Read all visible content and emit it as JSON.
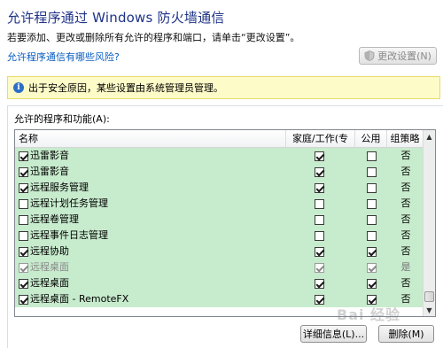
{
  "header": {
    "title": "允许程序通过 Windows 防火墙通信",
    "subtitle": "若要添加、更改或删除所有允许的程序和端口，请单击“更改设置”。",
    "help_link": "允许程序通信有哪些风险?",
    "change_settings_label": "更改设置(N)"
  },
  "infobar": {
    "text": "出于安全原因，某些设置由系统管理员管理。",
    "icon": "info-icon"
  },
  "programs": {
    "group_label": "允许的程序和功能(A):",
    "columns": {
      "name": "名称",
      "home": "家庭/工作(专用)",
      "public": "公用",
      "group_policy": "组策略"
    },
    "rows": [
      {
        "name": "迅雷影音",
        "enabled": true,
        "home": true,
        "public": false,
        "policy": "否",
        "disabled": false
      },
      {
        "name": "迅雷影音",
        "enabled": true,
        "home": true,
        "public": false,
        "policy": "否",
        "disabled": false
      },
      {
        "name": "远程服务管理",
        "enabled": true,
        "home": true,
        "public": false,
        "policy": "否",
        "disabled": false
      },
      {
        "name": "远程计划任务管理",
        "enabled": false,
        "home": false,
        "public": false,
        "policy": "否",
        "disabled": false
      },
      {
        "name": "远程卷管理",
        "enabled": false,
        "home": false,
        "public": false,
        "policy": "否",
        "disabled": false
      },
      {
        "name": "远程事件日志管理",
        "enabled": false,
        "home": false,
        "public": false,
        "policy": "否",
        "disabled": false
      },
      {
        "name": "远程协助",
        "enabled": true,
        "home": true,
        "public": true,
        "policy": "否",
        "disabled": false
      },
      {
        "name": "远程桌面",
        "enabled": true,
        "home": true,
        "public": true,
        "policy": "是",
        "disabled": true
      },
      {
        "name": "远程桌面",
        "enabled": true,
        "home": true,
        "public": true,
        "policy": "否",
        "disabled": false
      },
      {
        "name": "远程桌面 - RemoteFX",
        "enabled": true,
        "home": true,
        "public": true,
        "policy": "否",
        "disabled": false
      }
    ],
    "scroll_up": "▲",
    "scroll_down": "▼"
  },
  "footer": {
    "details_label": "详细信息(L)...",
    "remove_label": "删除(M)"
  },
  "watermark": "Bai 经验"
}
